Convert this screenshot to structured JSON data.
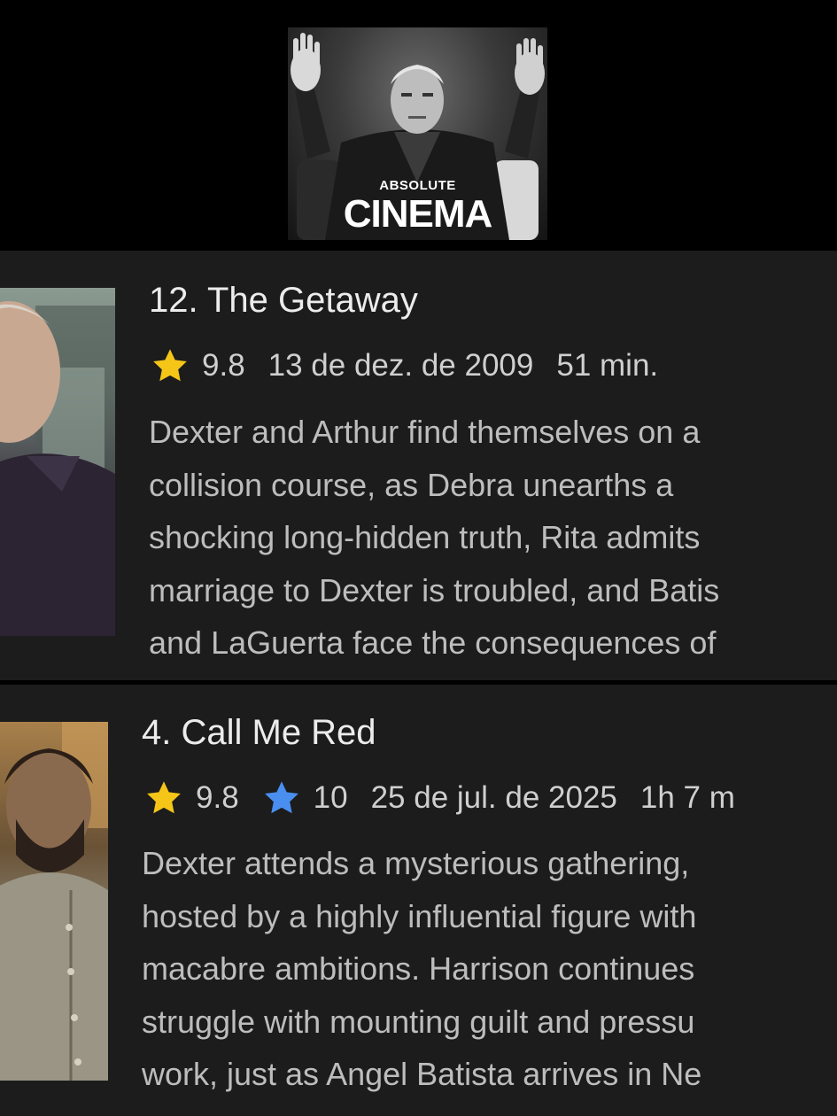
{
  "meme": {
    "small_text": "ABSOLUTE",
    "big_text": "CINEMA"
  },
  "episodes": [
    {
      "title": "12. The Getaway",
      "rating_icon": "star-icon",
      "rating_color": "#f5c518",
      "rating": "9.8",
      "date": "13 de dez. de 2009",
      "duration": "51 min.",
      "description_lines": [
        "Dexter and Arthur find themselves on a",
        "collision course, as Debra unearths a",
        "shocking long-hidden truth, Rita admits",
        "marriage to Dexter is troubled, and Batis",
        "and LaGuerta face the consequences of"
      ]
    },
    {
      "title": "4. Call Me Red",
      "rating_icon": "star-icon",
      "rating_color": "#f5c518",
      "rating": "9.8",
      "user_rating_icon": "star-icon",
      "user_rating_color": "#4a8ff0",
      "user_rating": "10",
      "date": "25 de jul. de 2025",
      "duration": "1h 7 m",
      "description_lines": [
        "Dexter attends a mysterious gathering,",
        "hosted by a highly influential figure with",
        "macabre ambitions. Harrison continues",
        "struggle with mounting guilt and pressu",
        "work, just as Angel Batista arrives in Ne"
      ]
    }
  ]
}
